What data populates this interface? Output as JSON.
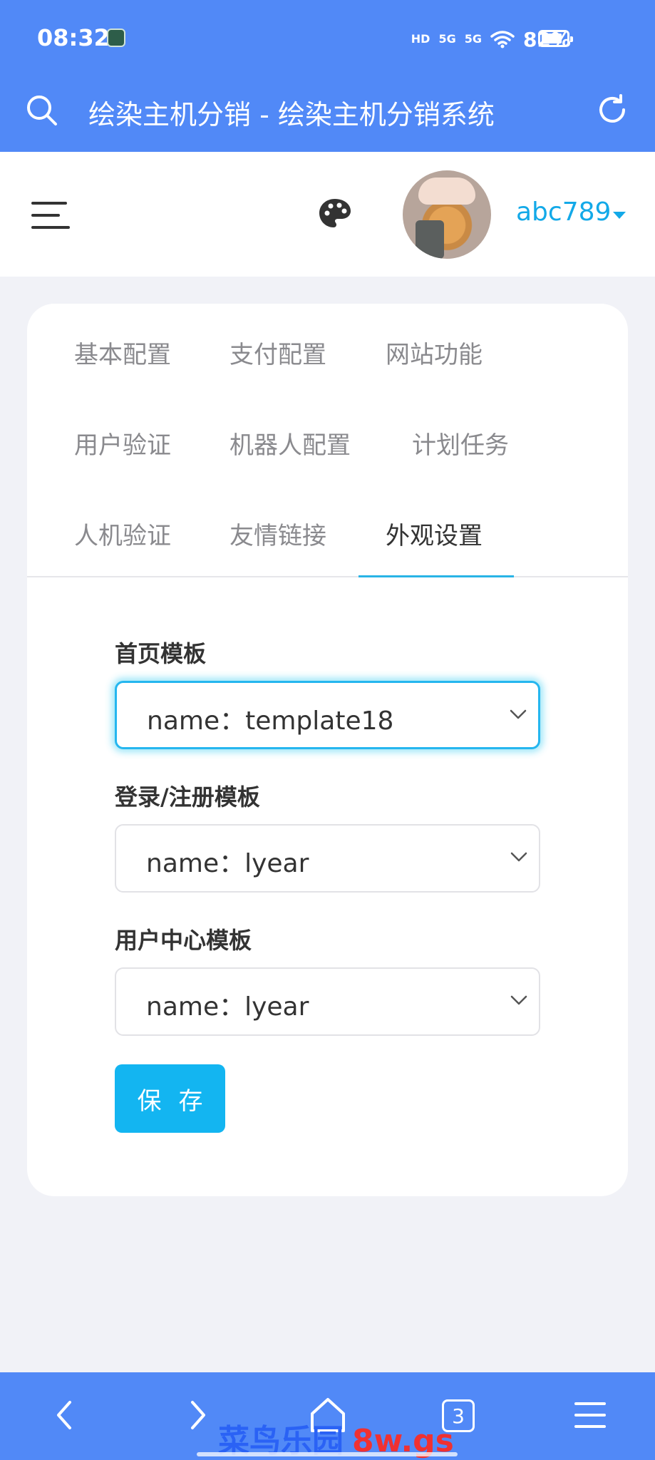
{
  "status_bar": {
    "time": "08:32",
    "network_hd": "HD",
    "network_5g_1": "5G",
    "network_5g_2": "5G",
    "battery": "82%"
  },
  "browser": {
    "title": "绘染主机分销 - 绘染主机分销系统",
    "search_icon": "search-icon",
    "reload_icon": "reload-icon"
  },
  "header": {
    "menu_icon": "hamburger-icon",
    "theme_icon": "palette-icon",
    "username": "abc789"
  },
  "tabs": [
    {
      "label": "基本配置"
    },
    {
      "label": "支付配置"
    },
    {
      "label": "网站功能"
    },
    {
      "label": "用户验证"
    },
    {
      "label": "机器人配置"
    },
    {
      "label": "计划任务"
    },
    {
      "label": "人机验证"
    },
    {
      "label": "友情链接"
    },
    {
      "label": "外观设置",
      "active": true
    }
  ],
  "form": {
    "fields": [
      {
        "label": "首页模板",
        "value": "name：template18"
      },
      {
        "label": "登录/注册模板",
        "value": "name：lyear"
      },
      {
        "label": "用户中心模板",
        "value": "name：lyear"
      }
    ],
    "save_label": "保存"
  },
  "bottom_nav": {
    "tab_count": "3",
    "watermark_cn": "菜鸟乐园",
    "watermark_en": "8w.gs"
  },
  "colors": {
    "brand_blue": "#5189f7",
    "accent_cyan": "#13b5f1",
    "username_color": "#13a9e8"
  }
}
